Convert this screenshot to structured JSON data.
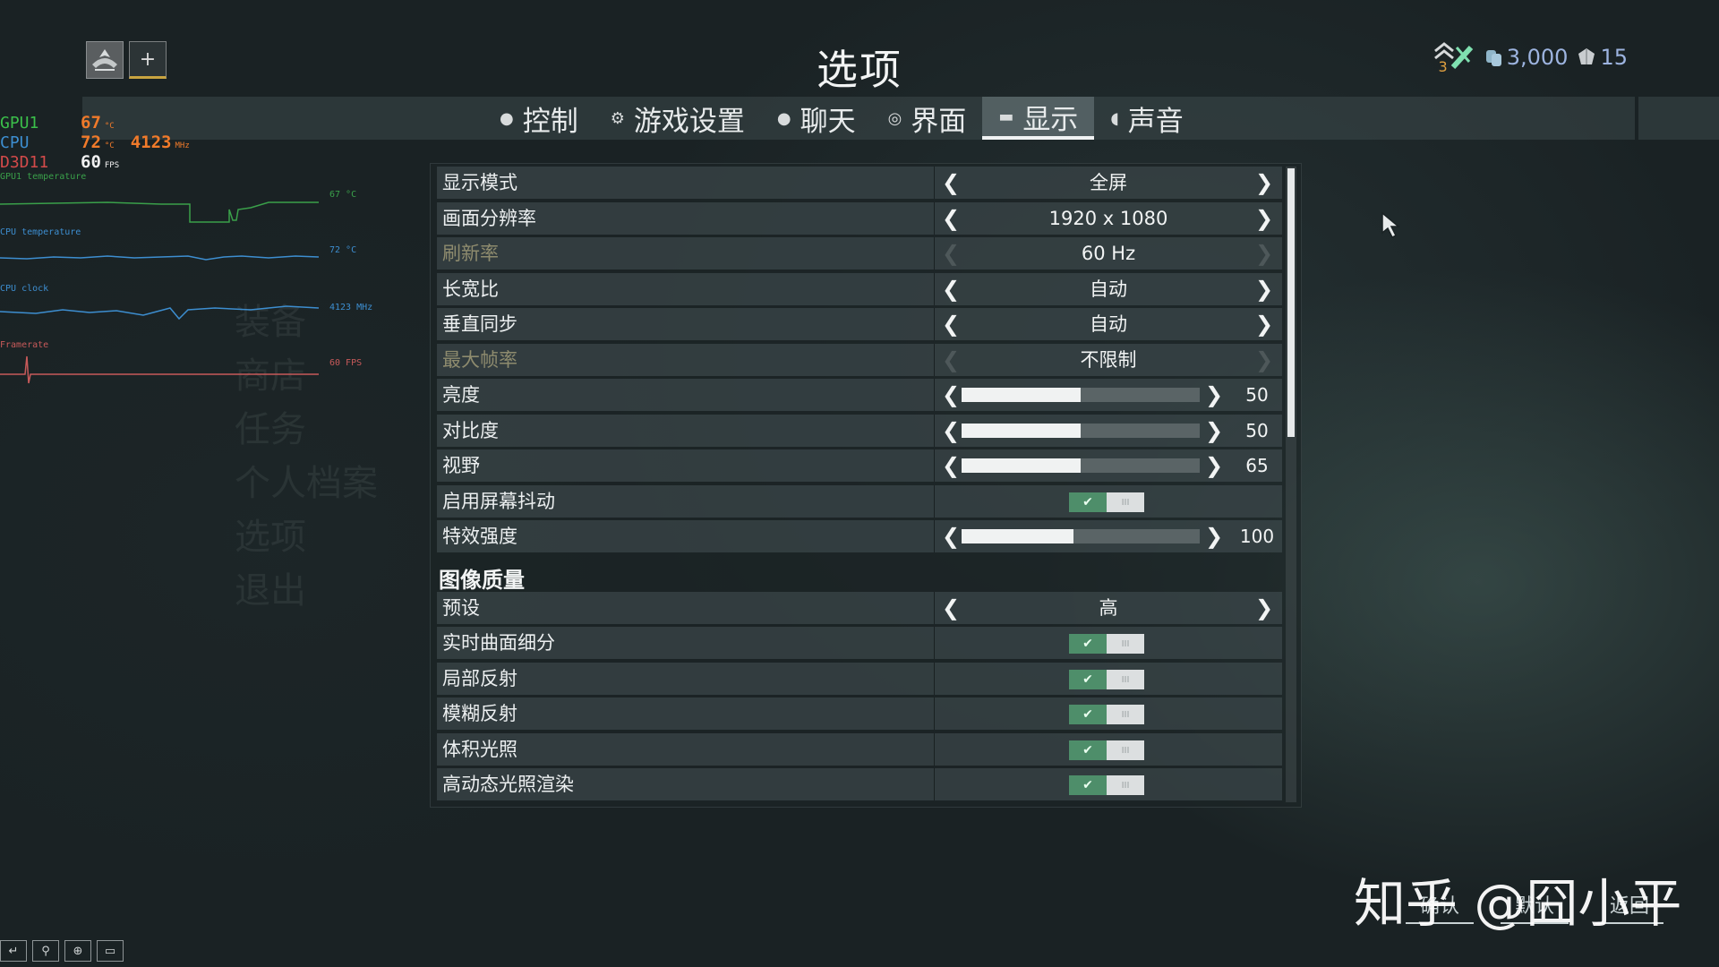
{
  "header": {
    "title": "选项",
    "plus_label": "+",
    "currency": {
      "rank": "3",
      "credits": "3,000",
      "platinum": "15"
    }
  },
  "tabs": [
    {
      "label": "控制",
      "icon": "mouse-icon"
    },
    {
      "label": "游戏设置",
      "icon": "gear-icon"
    },
    {
      "label": "聊天",
      "icon": "chat-bubble-icon"
    },
    {
      "label": "界面",
      "icon": "compass-icon"
    },
    {
      "label": "显示",
      "icon": "monitor-icon",
      "active": true
    },
    {
      "label": "声音",
      "icon": "speaker-icon"
    }
  ],
  "perf": {
    "gpu_label": "GPU1",
    "gpu_temp": "67",
    "gpu_unit": "°C",
    "cpu_label": "CPU",
    "cpu_temp": "72",
    "cpu_unit": "°C",
    "cpu_clock": "4123",
    "clock_unit": "MHz",
    "api_label": "D3D11",
    "fps": "60",
    "fps_unit": "FPS",
    "graphs": [
      {
        "label": "GPU1 temperature",
        "value": "67 °C",
        "color": "#3aa04a"
      },
      {
        "label": "CPU temperature",
        "value": "72 °C",
        "color": "#3d8ed0"
      },
      {
        "label": "CPU clock",
        "value": "4123 MHz",
        "color": "#3d8ed0"
      },
      {
        "label": "Framerate",
        "value": "60 FPS",
        "color": "#c85a5a"
      }
    ]
  },
  "options": {
    "display_mode": {
      "label": "显示模式",
      "value": "全屏"
    },
    "resolution": {
      "label": "画面分辨率",
      "value": "1920 x 1080"
    },
    "refresh_rate": {
      "label": "刷新率",
      "value": "60 Hz"
    },
    "aspect_ratio": {
      "label": "长宽比",
      "value": "自动"
    },
    "vsync": {
      "label": "垂直同步",
      "value": "自动"
    },
    "max_fps": {
      "label": "最大帧率",
      "value": "不限制"
    },
    "brightness": {
      "label": "亮度",
      "value": "50",
      "fill": 0.5
    },
    "contrast": {
      "label": "对比度",
      "value": "50",
      "fill": 0.5
    },
    "fov": {
      "label": "视野",
      "value": "65",
      "fill": 0.5
    },
    "screen_shake": {
      "label": "启用屏幕抖动",
      "on": true
    },
    "effects_intensity": {
      "label": "特效强度",
      "value": "100",
      "fill": 0.47
    }
  },
  "image_quality": {
    "section_title": "图像质量",
    "preset": {
      "label": "预设",
      "value": "高"
    },
    "tessellation": {
      "label": "实时曲面细分",
      "on": true
    },
    "local_reflections": {
      "label": "局部反射",
      "on": true
    },
    "blur_reflections": {
      "label": "模糊反射",
      "on": true
    },
    "volumetric_lighting": {
      "label": "体积光照",
      "on": true
    },
    "hdr_rendering": {
      "label": "高动态光照渲染",
      "on": true
    }
  },
  "toggle_on_glyph": "✔",
  "toggle_off_glyph": "III",
  "bottom": {
    "confirm": "确认",
    "default": "默认",
    "back": "返回"
  },
  "watermark": "知乎 @囧小平"
}
